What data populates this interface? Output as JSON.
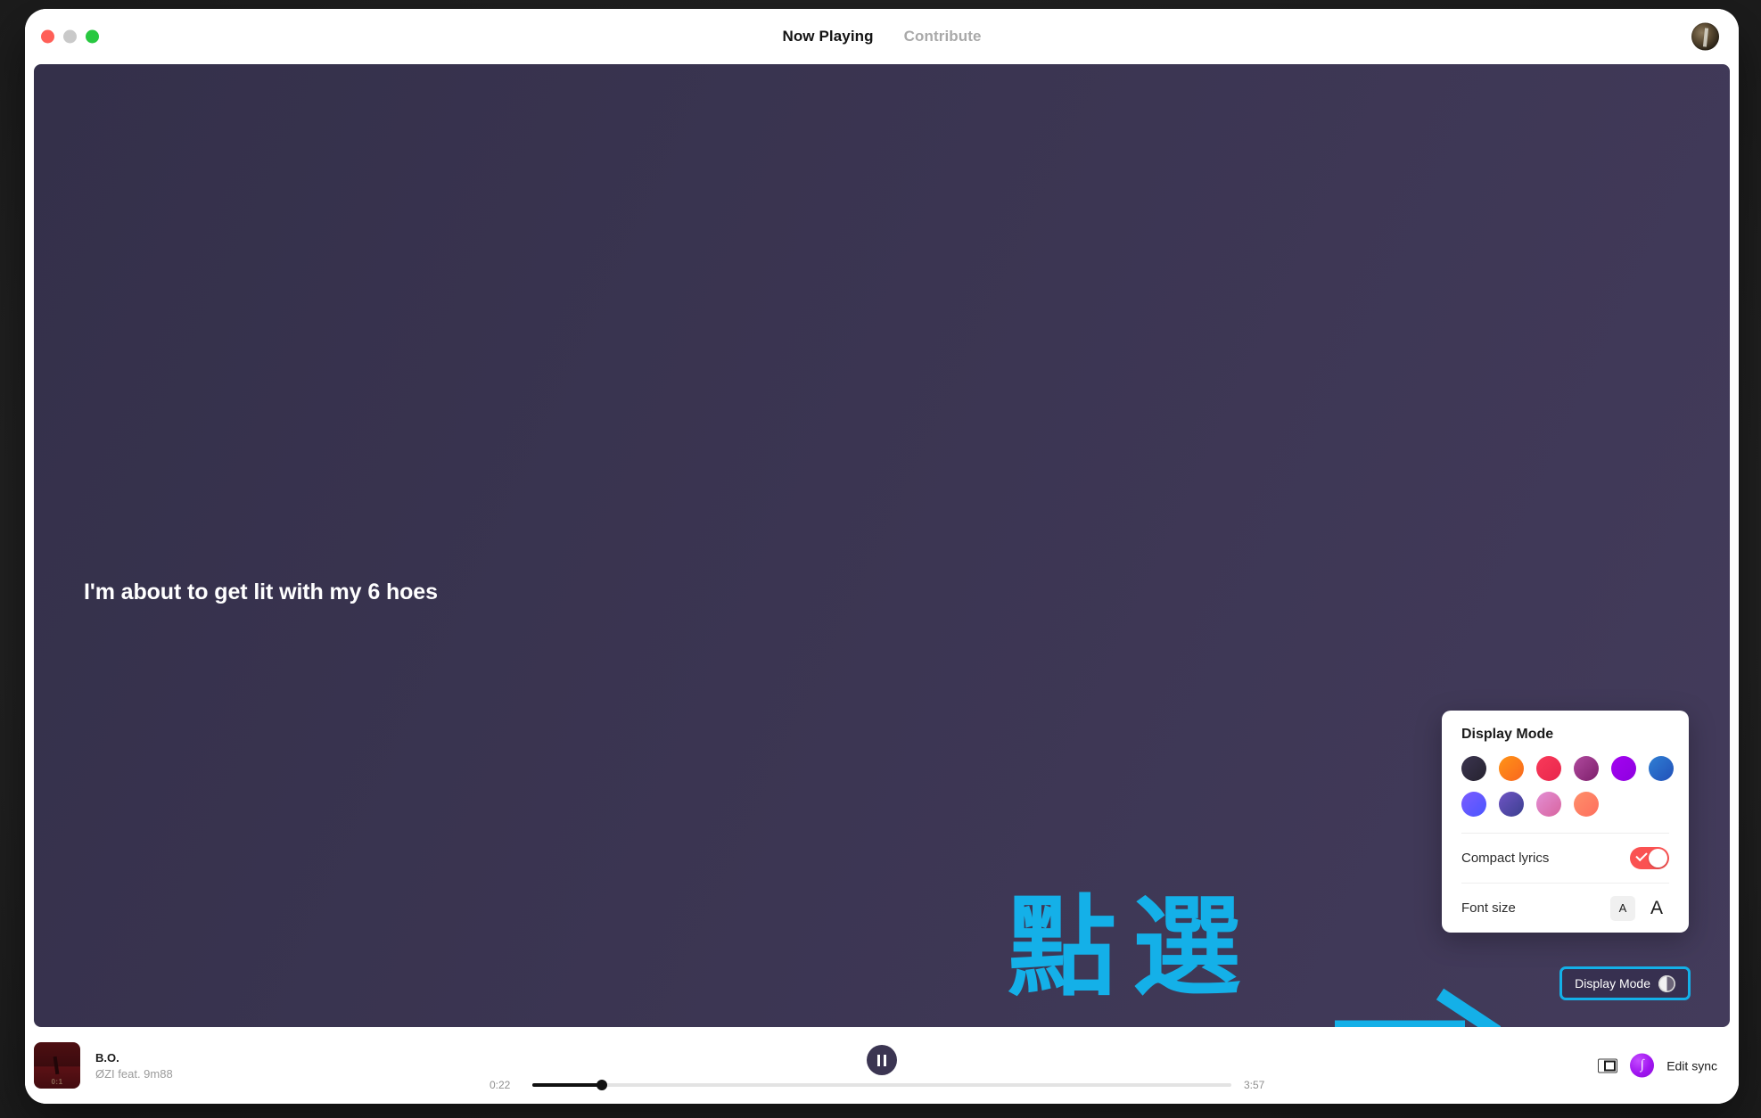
{
  "window": {
    "traffic_lights": [
      "close",
      "minimize",
      "maximize"
    ],
    "nav": [
      {
        "label": "Now Playing",
        "state": "active"
      },
      {
        "label": "Contribute",
        "state": "inactive"
      }
    ],
    "avatar_alt": "user-avatar"
  },
  "stage": {
    "background_from": "#34304a",
    "background_to": "#433b5b",
    "lyric_line": "I'm about to get lit with my 6 hoes",
    "annotation": {
      "text": "點選",
      "color": "#14b0e8",
      "arrow": "right-arrow"
    }
  },
  "popover": {
    "title": "Display Mode",
    "swatches": [
      {
        "name": "dark-charcoal",
        "from": "#3b3550",
        "to": "#26222f"
      },
      {
        "name": "orange",
        "from": "#ff9416",
        "to": "#f9661f"
      },
      {
        "name": "red-pink",
        "from": "#f93a5a",
        "to": "#e8264c"
      },
      {
        "name": "magenta-plum",
        "from": "#b04a9e",
        "to": "#7d1f6b"
      },
      {
        "name": "violet",
        "from": "#a304f0",
        "to": "#8e00e0"
      },
      {
        "name": "blue",
        "from": "#2f7fd4",
        "to": "#2250b8"
      },
      {
        "name": "indigo-blue",
        "from": "#7b5cff",
        "to": "#4a56ff"
      },
      {
        "name": "deep-purple",
        "from": "#6f54c4",
        "to": "#3b3f8f"
      },
      {
        "name": "pink-lavender",
        "from": "#e38fd4",
        "to": "#d8649f"
      },
      {
        "name": "coral",
        "from": "#ff8f6a",
        "to": "#fd6f5e"
      }
    ],
    "compact_lyrics": {
      "label": "Compact lyrics",
      "enabled": true,
      "accent": "#fa5252"
    },
    "font_size": {
      "label": "Font size",
      "options": [
        {
          "glyph": "A",
          "size": "small",
          "selected": true
        },
        {
          "glyph": "A",
          "size": "large",
          "selected": false
        }
      ]
    }
  },
  "display_mode_button": {
    "label": "Display Mode",
    "icon": "half-circle-icon",
    "highlight_color": "#14b0e8"
  },
  "player": {
    "track": {
      "title": "B.O.",
      "artist": "ØZI feat. 9m88",
      "cover_label": "0:1"
    },
    "transport": {
      "state": "playing",
      "button": "pause-button"
    },
    "progress": {
      "current_time": "0:22",
      "total_time": "3:57",
      "percent": 10
    },
    "right": {
      "mini_player_icon": "mini-player-icon",
      "sync_logo": "∫",
      "edit_sync_label": "Edit sync"
    }
  }
}
